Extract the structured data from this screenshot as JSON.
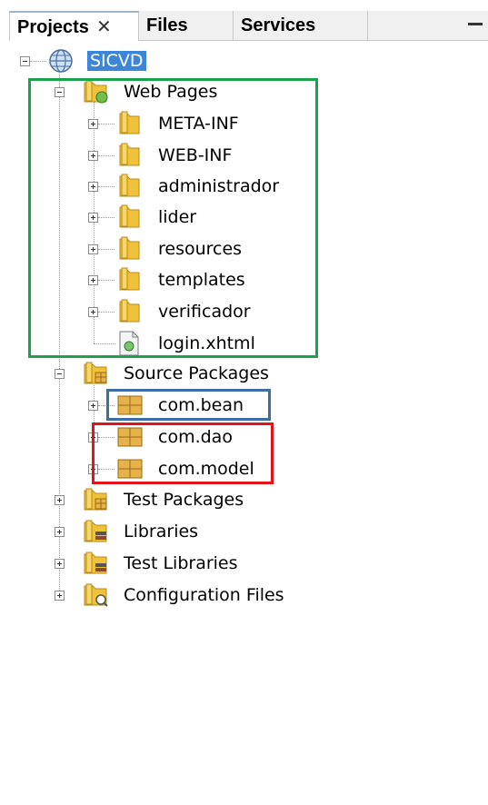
{
  "tabs": [
    {
      "label": "Projects",
      "close": "✕"
    },
    {
      "label": "Files"
    },
    {
      "label": "Services"
    }
  ],
  "tree": {
    "root": "SICVD",
    "web_pages": {
      "label": "Web Pages",
      "children": [
        "META-INF",
        "WEB-INF",
        "administrador",
        "lider",
        "resources",
        "templates",
        "verificador"
      ],
      "file": "login.xhtml"
    },
    "source_packages": {
      "label": "Source Packages",
      "packages": [
        "com.bean",
        "com.dao",
        "com.model"
      ]
    },
    "test_packages": "Test Packages",
    "libraries": "Libraries",
    "test_libraries": "Test Libraries",
    "configuration_files": "Configuration Files"
  },
  "highlights": {
    "green": "#1aa34a",
    "blue": "#3a6ea5",
    "red": "#e3131b"
  },
  "colors": {
    "selection": "#3b86d6",
    "folder": "#f0c23a",
    "package": "#e6b24a"
  }
}
